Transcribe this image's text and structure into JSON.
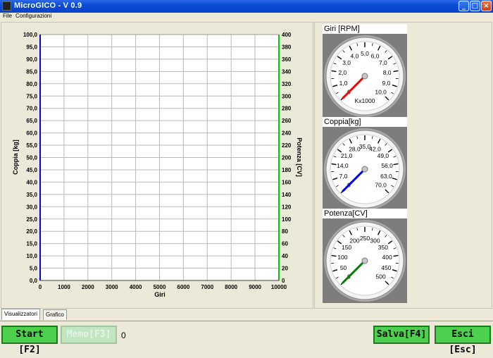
{
  "window": {
    "title": "MicroGICO - V 0.9"
  },
  "menu": [
    {
      "label": "File"
    },
    {
      "label": "Configurazioni"
    }
  ],
  "chart_data": {
    "type": "line",
    "title": "",
    "xlabel": "Giri",
    "ylabel_left": "Coppia [kg]",
    "ylabel_right": "Potenza [CV]",
    "xlim": [
      0,
      10000
    ],
    "ylim_left": [
      0,
      100
    ],
    "ylim_right": [
      0,
      400
    ],
    "x_ticks": [
      "0",
      "1000",
      "2000",
      "3000",
      "4000",
      "5000",
      "6000",
      "7000",
      "8000",
      "9000",
      "10000"
    ],
    "y_left_ticks": [
      "0,0",
      "5,0",
      "10,0",
      "15,0",
      "20,0",
      "25,0",
      "30,0",
      "35,0",
      "40,0",
      "45,0",
      "50,0",
      "55,0",
      "60,0",
      "65,0",
      "70,0",
      "75,0",
      "80,0",
      "85,0",
      "90,0",
      "95,0",
      "100,0"
    ],
    "y_right_ticks": [
      "0",
      "20",
      "40",
      "60",
      "80",
      "100",
      "120",
      "140",
      "160",
      "180",
      "200",
      "220",
      "240",
      "260",
      "280",
      "300",
      "320",
      "340",
      "360",
      "380",
      "400"
    ],
    "grid": true,
    "series": []
  },
  "gauges": [
    {
      "title": "Giri [RPM]",
      "unit_label": "Kx1000",
      "labels": [
        "0",
        "1,0",
        "2,0",
        "3,0",
        "4,0",
        "5,0",
        "6,0",
        "7,0",
        "8,0",
        "9,0",
        "10,0"
      ],
      "min": 0,
      "max": 10,
      "value": 0,
      "needle_color": "#ff0000"
    },
    {
      "title": "Coppia[kg]",
      "unit_label": "",
      "labels": [
        "0",
        "7,0",
        "14,0",
        "21,0",
        "28,0",
        "35,0",
        "42,0",
        "49,0",
        "56,0",
        "63,0",
        "70,0"
      ],
      "min": 0,
      "max": 70,
      "value": 0,
      "needle_color": "#0000ff"
    },
    {
      "title": "Potenza[CV]",
      "unit_label": "",
      "labels": [
        "0",
        "50",
        "100",
        "150",
        "200",
        "250",
        "300",
        "350",
        "400",
        "450",
        "500"
      ],
      "min": 0,
      "max": 500,
      "value": 0,
      "needle_color": "#008000"
    }
  ],
  "tabs": [
    {
      "label": "Visualizzatori",
      "active": true
    },
    {
      "label": "Grafico",
      "active": false
    }
  ],
  "buttons": {
    "start": "Start [F2]",
    "memo": "Memo[F3]",
    "salva": "Salva[F4]",
    "esci": "Esci [Esc]"
  },
  "counter": "0",
  "colors": {
    "left_axis": "#0000ff",
    "right_axis": "#00cc00",
    "button_green": "#4dd04d"
  }
}
